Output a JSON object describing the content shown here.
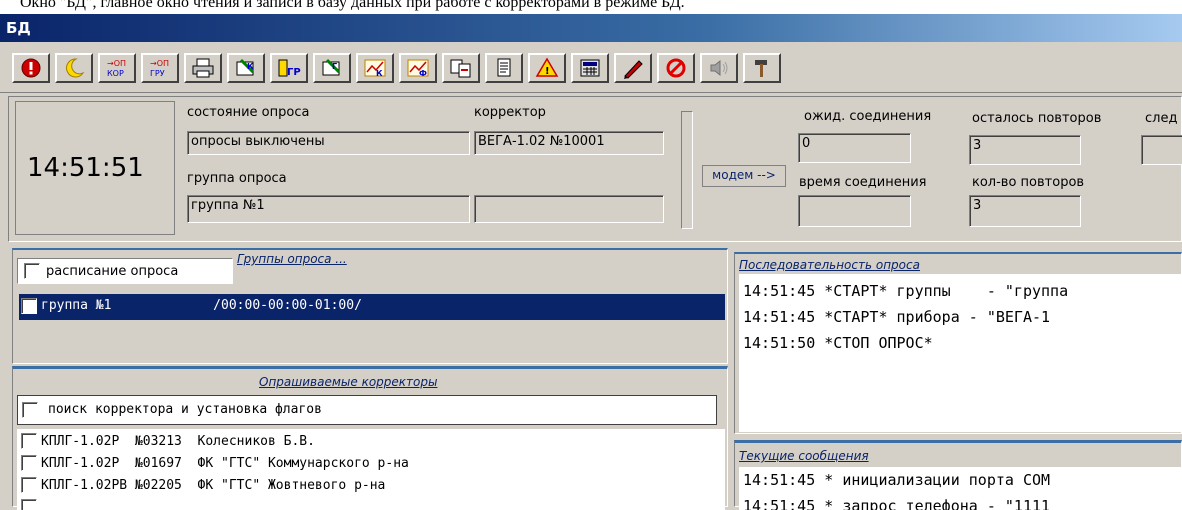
{
  "caption": "Окно \"БД\", главное окно чтения и записи в базу данных при работе с корректорами в режиме БД.",
  "window": {
    "title": "БД"
  },
  "toolbar": {
    "buttons": [
      {
        "name": "stop-icon",
        "label": ""
      },
      {
        "name": "moon-icon",
        "label": ""
      },
      {
        "name": "poll-corrector-icon",
        "label": "→ОП КОР"
      },
      {
        "name": "poll-group-icon",
        "label": "→ОП ГРУ"
      },
      {
        "name": "print-icon",
        "label": ""
      },
      {
        "name": "corrector-edit-icon",
        "label": ""
      },
      {
        "name": "gr-icon",
        "label": "ГР"
      },
      {
        "name": "group-edit-icon",
        "label": ""
      },
      {
        "name": "chart-k-icon",
        "label": ""
      },
      {
        "name": "chart-f-icon",
        "label": ""
      },
      {
        "name": "copy-icon",
        "label": ""
      },
      {
        "name": "page-icon",
        "label": ""
      },
      {
        "name": "alarm-icon",
        "label": ""
      },
      {
        "name": "calculator-icon",
        "label": ""
      },
      {
        "name": "pen-icon",
        "label": ""
      },
      {
        "name": "forbid-icon",
        "label": ""
      },
      {
        "name": "sound-icon",
        "label": ""
      },
      {
        "name": "hammer-icon",
        "label": ""
      }
    ]
  },
  "status": {
    "clock": "14:51:51",
    "poll_state_label": "состояние опроса",
    "poll_state_value": "опросы выключены",
    "corrector_label": "корректор",
    "corrector_value": "ВЕГА-1.02  №10001",
    "group_label": "группа опроса",
    "group_value": "группа №1",
    "group_extra_value": "",
    "modem_button": "модем -->",
    "wait_conn_label": "ожид. соединения",
    "wait_conn_value": "0",
    "conn_time_label": "время соединения",
    "conn_time_value": "",
    "retries_left_label": "осталось повторов",
    "retries_left_value": "3",
    "retries_count_label": "кол-во повторов",
    "retries_count_value": "3",
    "next_label": "след"
  },
  "schedule": {
    "checkbox_label": "расписание опроса",
    "groups_title": "Группы опроса ...",
    "groups": [
      {
        "text": "группа №1             /00:00-00:00-01:00/"
      }
    ]
  },
  "correctors": {
    "title": "Опрашиваемые корректоры",
    "search_label": "поиск корректора и установка флагов",
    "items": [
      {
        "text": "КПЛГ-1.02Р  №03213  Колесников Б.В."
      },
      {
        "text": "КПЛГ-1.02Р  №01697  ФК \"ГТС\" Коммунарского р-на"
      },
      {
        "text": "КПЛГ-1.02РВ №02205  ФК \"ГТС\" Жовтневого р-на"
      }
    ]
  },
  "sequence": {
    "title": "Последовательность опроса",
    "lines": [
      "14:51:45 *СТАРТ* группы    - \"группа",
      "14:51:45 *СТАРТ* прибора - \"ВЕГА-1",
      "14:51:50 *СТОП ОПРОС*"
    ]
  },
  "messages": {
    "title": "Текущие сообщения",
    "lines": [
      "14:51:45 * инициализации порта COM",
      "14:51:45 * запрос телефона - \"1111"
    ]
  }
}
